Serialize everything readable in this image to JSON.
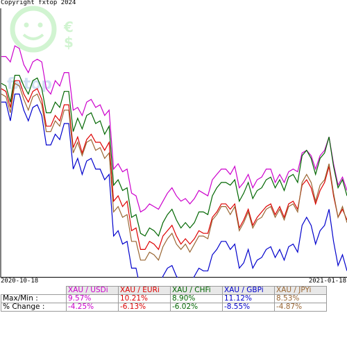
{
  "copyright": "Copyright fxtop 2024",
  "logo_text": "fxtop",
  "chart_data": {
    "type": "line",
    "x_start": "2020-10-18",
    "x_end": "2021-01-18",
    "title": "",
    "xlabel": "",
    "ylabel": "",
    "normalized_index": "percent of range (0 = series min, 100 = series max)",
    "series": [
      {
        "name": "XAU / USDi",
        "color": "#cc00cc",
        "max_min": "9.57%",
        "pct_change": "-4.25%",
        "values": [
          82,
          82,
          80,
          86,
          85,
          79,
          76,
          80,
          81,
          80,
          70,
          68,
          73,
          71,
          76,
          76,
          62,
          63,
          60,
          65,
          66,
          63,
          64,
          60,
          62,
          40,
          42,
          39,
          40,
          31,
          30,
          24,
          25,
          27,
          26,
          25,
          28,
          31,
          33,
          30,
          28,
          29,
          27,
          29,
          32,
          31,
          30,
          36,
          38,
          40,
          40,
          38,
          41,
          33,
          35,
          38,
          33,
          36,
          37,
          40,
          40,
          35,
          38,
          35,
          39,
          40,
          39,
          46,
          47,
          45,
          40,
          45,
          47,
          52,
          42,
          34,
          37,
          32
        ]
      },
      {
        "name": "XAU / EURi",
        "color": "#dd0000",
        "max_min": "10.21%",
        "pct_change": "-6.13%",
        "values": [
          70,
          69,
          63,
          73,
          73,
          68,
          65,
          69,
          70,
          66,
          56,
          56,
          60,
          58,
          64,
          64,
          48,
          52,
          46,
          51,
          53,
          50,
          50,
          47,
          50,
          28,
          30,
          26,
          28,
          17,
          18,
          10,
          10,
          13,
          12,
          10,
          15,
          17,
          19,
          15,
          12,
          14,
          12,
          14,
          17,
          16,
          16,
          22,
          24,
          27,
          27,
          25,
          27,
          18,
          21,
          25,
          19,
          22,
          24,
          26,
          27,
          23,
          26,
          22,
          27,
          28,
          25,
          34,
          36,
          33,
          27,
          32,
          35,
          41,
          30,
          22,
          25,
          21
        ]
      },
      {
        "name": "XAU / CHFi",
        "color": "#006600",
        "max_min": "8.90%",
        "pct_change": "-6.02%",
        "values": [
          72,
          71,
          65,
          75,
          75,
          71,
          68,
          73,
          74,
          70,
          61,
          61,
          65,
          63,
          69,
          69,
          54,
          59,
          55,
          60,
          61,
          57,
          58,
          53,
          56,
          34,
          36,
          32,
          33,
          22,
          23,
          16,
          15,
          18,
          17,
          15,
          20,
          23,
          25,
          21,
          18,
          20,
          18,
          20,
          24,
          24,
          23,
          30,
          33,
          35,
          35,
          34,
          36,
          28,
          31,
          35,
          29,
          32,
          33,
          36,
          37,
          33,
          36,
          32,
          37,
          38,
          35,
          45,
          47,
          44,
          38,
          44,
          46,
          52,
          41,
          33,
          36,
          30
        ]
      },
      {
        "name": "XAU / GBPi",
        "color": "#0000cc",
        "max_min": "11.12%",
        "pct_change": "-8.55%",
        "values": [
          65,
          65,
          58,
          68,
          68,
          62,
          58,
          63,
          64,
          60,
          49,
          49,
          53,
          51,
          57,
          57,
          40,
          44,
          38,
          43,
          44,
          40,
          40,
          36,
          38,
          15,
          17,
          12,
          13,
          3,
          3,
          -5,
          -5,
          -2,
          -3,
          -5,
          0,
          3,
          4,
          0,
          -2,
          -1,
          -3,
          0,
          3,
          2,
          2,
          8,
          10,
          13,
          13,
          10,
          12,
          3,
          5,
          10,
          3,
          6,
          7,
          10,
          11,
          7,
          10,
          6,
          11,
          12,
          9,
          19,
          22,
          19,
          12,
          17,
          19,
          25,
          13,
          4,
          8,
          2
        ]
      },
      {
        "name": "XAU / JPYi",
        "color": "#996633",
        "max_min": "8.53%",
        "pct_change": "-4.87%",
        "values": [
          68,
          67,
          61,
          72,
          71,
          66,
          62,
          67,
          68,
          64,
          54,
          54,
          58,
          56,
          62,
          62,
          46,
          50,
          45,
          50,
          51,
          47,
          48,
          44,
          46,
          24,
          26,
          22,
          23,
          13,
          13,
          6,
          6,
          9,
          8,
          6,
          11,
          14,
          16,
          12,
          10,
          12,
          9,
          12,
          15,
          15,
          14,
          21,
          23,
          26,
          26,
          23,
          26,
          17,
          20,
          24,
          18,
          21,
          22,
          25,
          26,
          22,
          25,
          21,
          26,
          27,
          24,
          35,
          38,
          35,
          28,
          34,
          36,
          42,
          31,
          22,
          26,
          20
        ]
      }
    ]
  },
  "table": {
    "row_max_min": "Max/Min :",
    "row_pct_change": "% Change :"
  }
}
